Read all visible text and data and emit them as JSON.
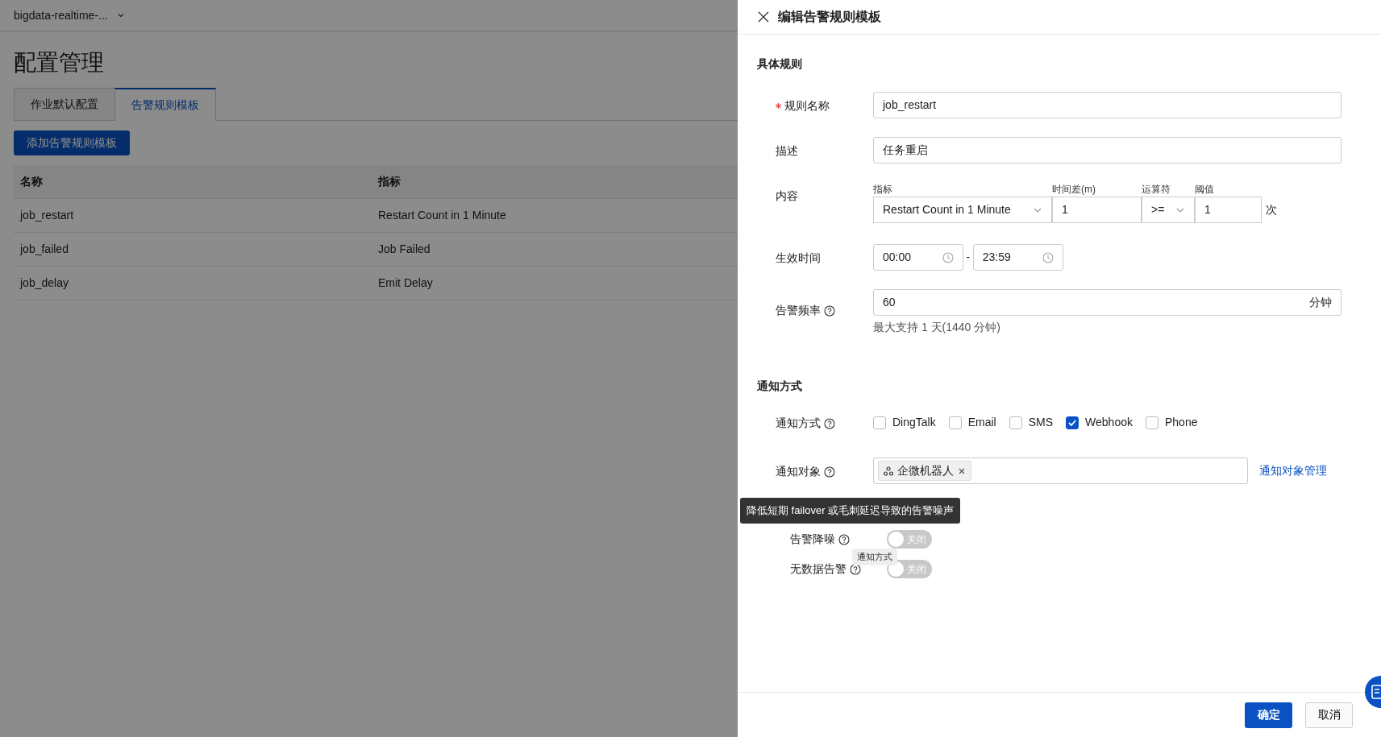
{
  "topbar": {
    "project": "bigdata-realtime-..."
  },
  "page": {
    "title": "配置管理",
    "tabs": [
      {
        "label": "作业默认配置",
        "selected": false
      },
      {
        "label": "告警规则模板",
        "selected": true
      }
    ],
    "add_button": "添加告警规则模板",
    "table": {
      "columns": [
        "名称",
        "指标"
      ],
      "rows": [
        [
          "job_restart",
          "Restart Count in 1 Minute"
        ],
        [
          "job_failed",
          "Job Failed"
        ],
        [
          "job_delay",
          "Emit Delay"
        ]
      ]
    }
  },
  "drawer": {
    "title": "编辑告警规则模板",
    "rule_section": "具体规则",
    "name": {
      "label": "规则名称",
      "required": true,
      "value": "job_restart"
    },
    "description": {
      "label": "描述",
      "value": "任务重启"
    },
    "content": {
      "label": "内容",
      "metric_label": "指标",
      "metric": "Restart Count in 1 Minute",
      "window_label": "时间差(m)",
      "window": "1",
      "operator_label": "运算符",
      "operator": ">=",
      "threshold_label": "阈值",
      "threshold": "1",
      "unit": "次"
    },
    "active_time": {
      "label": "生效时间",
      "start": "00:00",
      "separator": "-",
      "end": "23:59"
    },
    "frequency": {
      "label": "告警频率",
      "value": "60",
      "unit": "分钟",
      "hint": "最大支持 1 天(1440 分钟)"
    },
    "notify_section": "通知方式",
    "methods": {
      "label": "通知方式",
      "options": [
        {
          "label": "DingTalk",
          "checked": false
        },
        {
          "label": "Email",
          "checked": false
        },
        {
          "label": "SMS",
          "checked": false
        },
        {
          "label": "Webhook",
          "checked": true
        },
        {
          "label": "Phone",
          "checked": false
        }
      ]
    },
    "targets": {
      "label": "通知对象",
      "tags": [
        "企微机器人"
      ],
      "manage_link": "通知对象管理"
    },
    "tooltip": "降低短期 failover 或毛刺延迟导致的告警噪声",
    "switches": [
      {
        "label": "告警降噪",
        "on": false,
        "state_text": "关闭"
      },
      {
        "label": "无数据告警",
        "on": false,
        "state_text": "关闭"
      }
    ],
    "small_tooltip": "通知方式",
    "buttons": {
      "ok": "确定",
      "cancel": "取消"
    }
  }
}
